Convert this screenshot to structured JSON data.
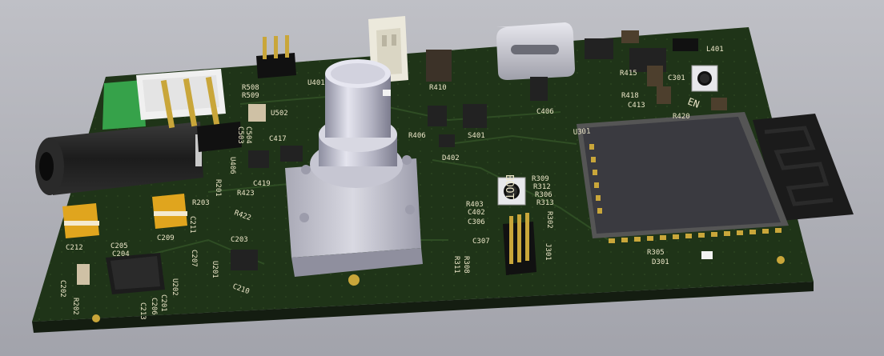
{
  "colors": {
    "background_top": "#bfc0c6",
    "background_bottom": "#a2a3ab",
    "pcb_top": "#1f3418",
    "pcb_side": "#141d11",
    "silkscreen": "#ece6c8",
    "gold": "#c9a63a",
    "component_black": "#222222",
    "rf_module": "#3a3a40",
    "antenna": "#1b1b1b",
    "encoder_body": "#c8c8d0",
    "usb_shell": "#cfd0d8",
    "capacitor_yellow": "#e0a51e"
  },
  "silkscreen_labels": {
    "boot": "BOOT",
    "en": "EN",
    "r305": "R305",
    "d301": "D301",
    "j301": "J301",
    "u301": "U301",
    "r309": "R309",
    "r312": "R312",
    "r306": "R306",
    "r313": "R313",
    "r302": "R302",
    "r403": "R403",
    "c402": "C402",
    "c306": "C306",
    "c307": "C307",
    "r308": "R308",
    "r311": "R311",
    "d402": "D402",
    "s401": "S401",
    "r406": "R406",
    "c406": "C406",
    "r410": "R410",
    "r415": "R415",
    "r418": "R418",
    "c413": "C413",
    "c301": "C301",
    "l401": "L401",
    "r420": "R420",
    "u401": "U401",
    "u502": "U502",
    "r508": "R508",
    "r509": "R509",
    "c419": "C419",
    "r423": "R423",
    "r422": "R422",
    "r203": "R203",
    "c203": "C203",
    "u201": "U201",
    "c210": "C210",
    "c212": "C212",
    "c209": "C209",
    "c211": "C211",
    "c202": "C202",
    "r202": "R202",
    "c207": "C207",
    "u202": "U202",
    "c201": "C201",
    "c206": "C206",
    "c213": "C213",
    "c205": "C205",
    "c204": "C204",
    "c417": "C417",
    "u406": "U406",
    "r201": "R201",
    "c503": "C503",
    "c504": "C504"
  }
}
